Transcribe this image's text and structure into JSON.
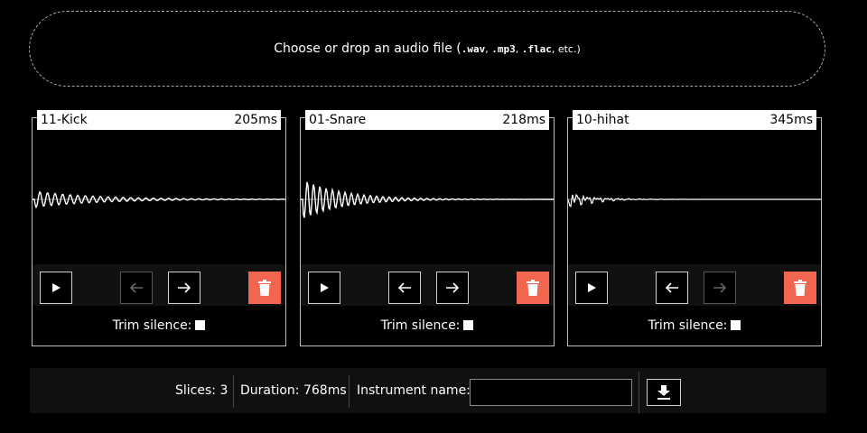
{
  "dropzone": {
    "prefix": "Choose or drop an audio file (",
    "ext1": ".wav",
    "sep1": ", ",
    "ext2": ".mp3",
    "sep2": ", ",
    "ext3": ".flac",
    "suffix": ", etc.)"
  },
  "slices": [
    {
      "name": "11-Kick",
      "duration": "205ms",
      "trim_label": "Trim silence:",
      "trim_checked": false
    },
    {
      "name": "01-Snare",
      "duration": "218ms",
      "trim_label": "Trim silence:",
      "trim_checked": false
    },
    {
      "name": "10-hihat",
      "duration": "345ms",
      "trim_label": "Trim silence:",
      "trim_checked": false
    }
  ],
  "footer": {
    "slices": "Slices: 3",
    "duration": "Duration: 768ms",
    "instrument_label": "Instrument name:",
    "instrument_value": ""
  },
  "icons": [
    "play-icon",
    "arrow-left-icon",
    "arrow-right-icon",
    "trash-icon",
    "download-icon"
  ],
  "colors": {
    "background": "#000000",
    "delete": "#f2654f",
    "waveform": "#ffffff"
  }
}
